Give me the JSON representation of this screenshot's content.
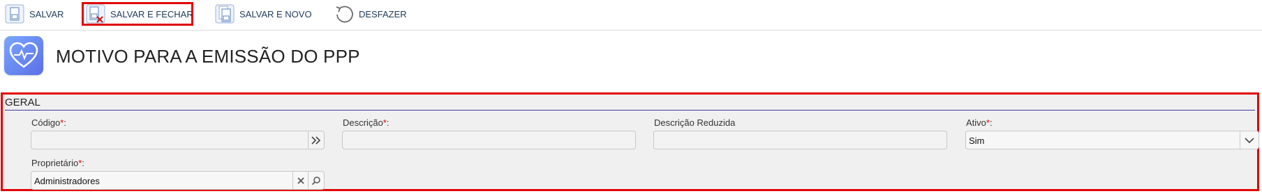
{
  "toolbar": {
    "save_label": "SALVAR",
    "save_close_label": "SALVAR E FECHAR",
    "save_new_label": "SALVAR E NOVO",
    "undo_label": "DESFAZER"
  },
  "page": {
    "title": "MOTIVO PARA A EMISSÃO DO PPP",
    "icon": "heart-pulse-icon"
  },
  "section": {
    "title": "GERAL",
    "fields": {
      "codigo": {
        "label": "Código",
        "required": "*",
        "value": ""
      },
      "descricao": {
        "label": "Descrição",
        "required": "*",
        "value": ""
      },
      "descricao_reduzida": {
        "label": "Descrição Reduzida",
        "value": ""
      },
      "ativo": {
        "label": "Ativo",
        "required": "*",
        "value": "Sim"
      },
      "proprietario": {
        "label": "Proprietário",
        "required": "*",
        "value": "Administradores"
      }
    }
  },
  "colors": {
    "highlight": "#e00000",
    "section_bg": "#f0f0f0",
    "accent": "#3a3aa0"
  }
}
